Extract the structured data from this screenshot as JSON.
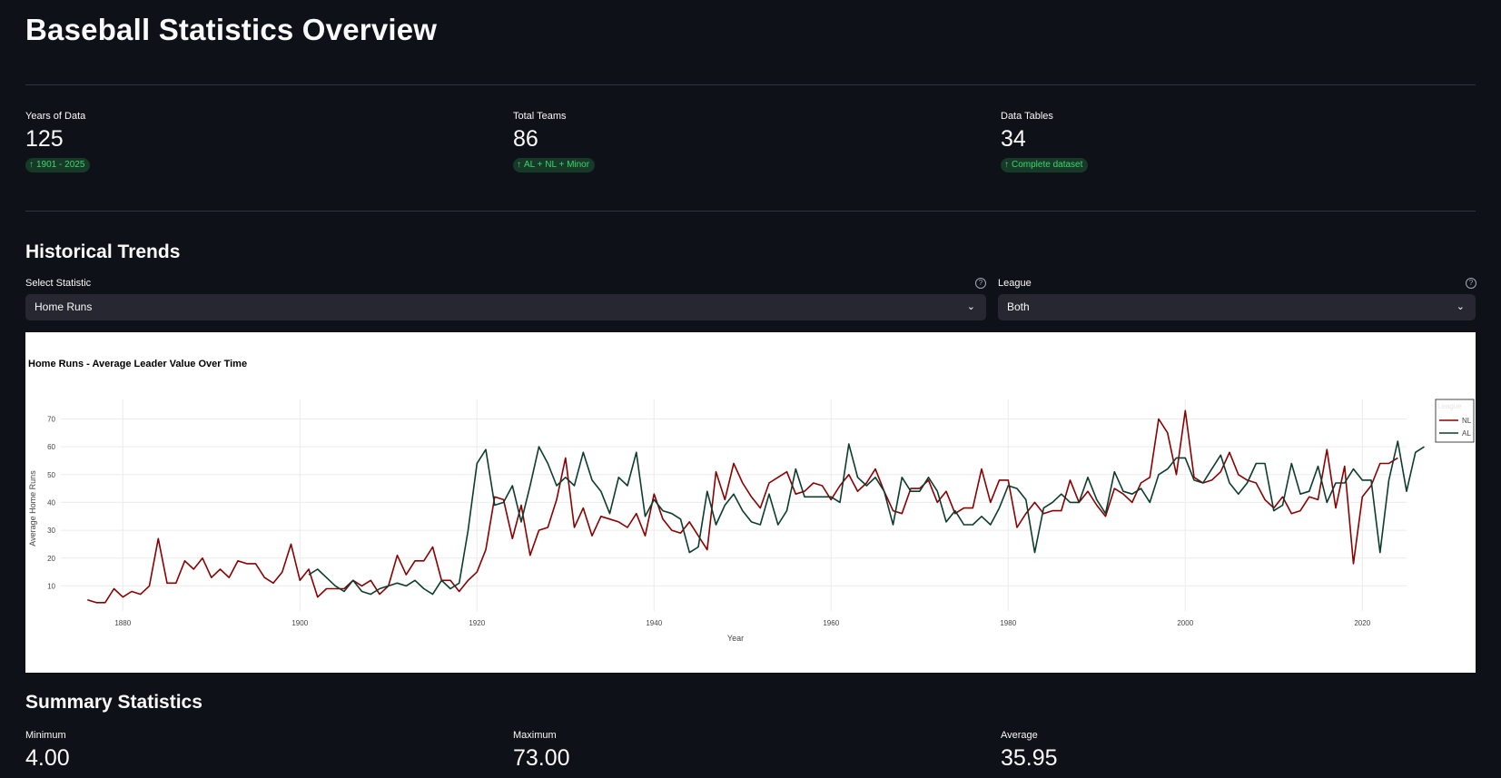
{
  "title": "Baseball Statistics Overview",
  "metrics": [
    {
      "label": "Years of Data",
      "value": "125",
      "delta": "1901 - 2025"
    },
    {
      "label": "Total Teams",
      "value": "86",
      "delta": "AL + NL + Minor"
    },
    {
      "label": "Data Tables",
      "value": "34",
      "delta": "Complete dataset"
    }
  ],
  "delta_icon": "↑",
  "trends": {
    "title": "Historical Trends",
    "statistic": {
      "label": "Select Statistic",
      "value": "Home Runs"
    },
    "league": {
      "label": "League",
      "value": "Both"
    }
  },
  "summary": {
    "title": "Summary Statistics",
    "stats": [
      {
        "label": "Minimum",
        "value": "4.00"
      },
      {
        "label": "Maximum",
        "value": "73.00"
      },
      {
        "label": "Average",
        "value": "35.95"
      }
    ]
  },
  "colors": {
    "NL": "#8b0000",
    "AL": "#0b3d2e",
    "delta_bg": "#173928",
    "delta_text": "#3dd56d"
  },
  "chart_data": {
    "type": "line",
    "title": "Home Runs - Average Leader Value Over Time",
    "xlabel": "Year",
    "ylabel": "Average Home Runs",
    "xlim": [
      1873,
      2025
    ],
    "ylim": [
      1,
      77
    ],
    "xticks": [
      1880,
      1900,
      1920,
      1940,
      1960,
      1980,
      2000,
      2020
    ],
    "yticks": [
      10,
      20,
      30,
      40,
      50,
      60,
      70
    ],
    "grid": true,
    "legend": {
      "title": "League",
      "position": "top-right"
    },
    "series": [
      {
        "name": "NL",
        "start_year": 1876,
        "values": [
          5,
          4,
          4,
          9,
          6,
          8,
          7,
          10,
          27,
          11,
          11,
          19,
          16,
          20,
          13,
          16,
          13,
          19,
          18,
          18,
          13,
          11,
          15,
          25,
          12,
          16,
          6,
          9,
          9,
          9,
          12,
          10,
          12,
          7,
          10,
          21,
          14,
          19,
          19,
          24,
          12,
          12,
          8,
          12,
          15,
          23,
          42,
          41,
          27,
          39,
          21,
          30,
          31,
          41,
          56,
          31,
          38,
          28,
          35,
          34,
          33,
          31,
          36,
          28,
          43,
          34,
          30,
          29,
          33,
          28,
          23,
          51,
          41,
          54,
          47,
          42,
          38,
          47,
          49,
          51,
          43,
          44,
          47,
          46,
          41,
          46,
          50,
          44,
          47,
          52,
          44,
          37,
          36,
          45,
          45,
          48,
          40,
          44,
          36,
          38,
          38,
          52,
          40,
          48,
          48,
          31,
          36,
          40,
          36,
          37,
          37,
          48,
          40,
          44,
          39,
          35,
          45,
          43,
          40,
          47,
          49,
          70,
          65,
          50,
          73,
          49,
          47,
          48,
          51,
          58,
          50,
          48,
          47,
          41,
          38,
          42,
          36,
          37,
          42,
          41,
          59,
          38,
          53,
          18,
          42,
          46,
          54,
          54,
          56
        ]
      },
      {
        "name": "AL",
        "start_year": 1901,
        "values": [
          14,
          16,
          13,
          10,
          8,
          12,
          8,
          7,
          9,
          10,
          11,
          10,
          12,
          9,
          7,
          12,
          9,
          11,
          30,
          54,
          59,
          39,
          40,
          46,
          33,
          46,
          60,
          54,
          46,
          49,
          46,
          58,
          48,
          44,
          36,
          49,
          46,
          58,
          35,
          41,
          37,
          36,
          34,
          22,
          24,
          44,
          32,
          39,
          43,
          37,
          33,
          32,
          43,
          32,
          37,
          52,
          42,
          42,
          42,
          42,
          40,
          61,
          49,
          46,
          49,
          44,
          32,
          49,
          44,
          44,
          49,
          44,
          33,
          37,
          32,
          32,
          35,
          32,
          38,
          46,
          45,
          41,
          22,
          38,
          40,
          43,
          40,
          40,
          49,
          41,
          36,
          51,
          44,
          43,
          45,
          40,
          50,
          52,
          56,
          56,
          48,
          47,
          52,
          57,
          47,
          43,
          47,
          54,
          54,
          37,
          39,
          54,
          43,
          44,
          53,
          40,
          47,
          47,
          52,
          48,
          48,
          22,
          48,
          62,
          44,
          58,
          60
        ]
      }
    ]
  }
}
